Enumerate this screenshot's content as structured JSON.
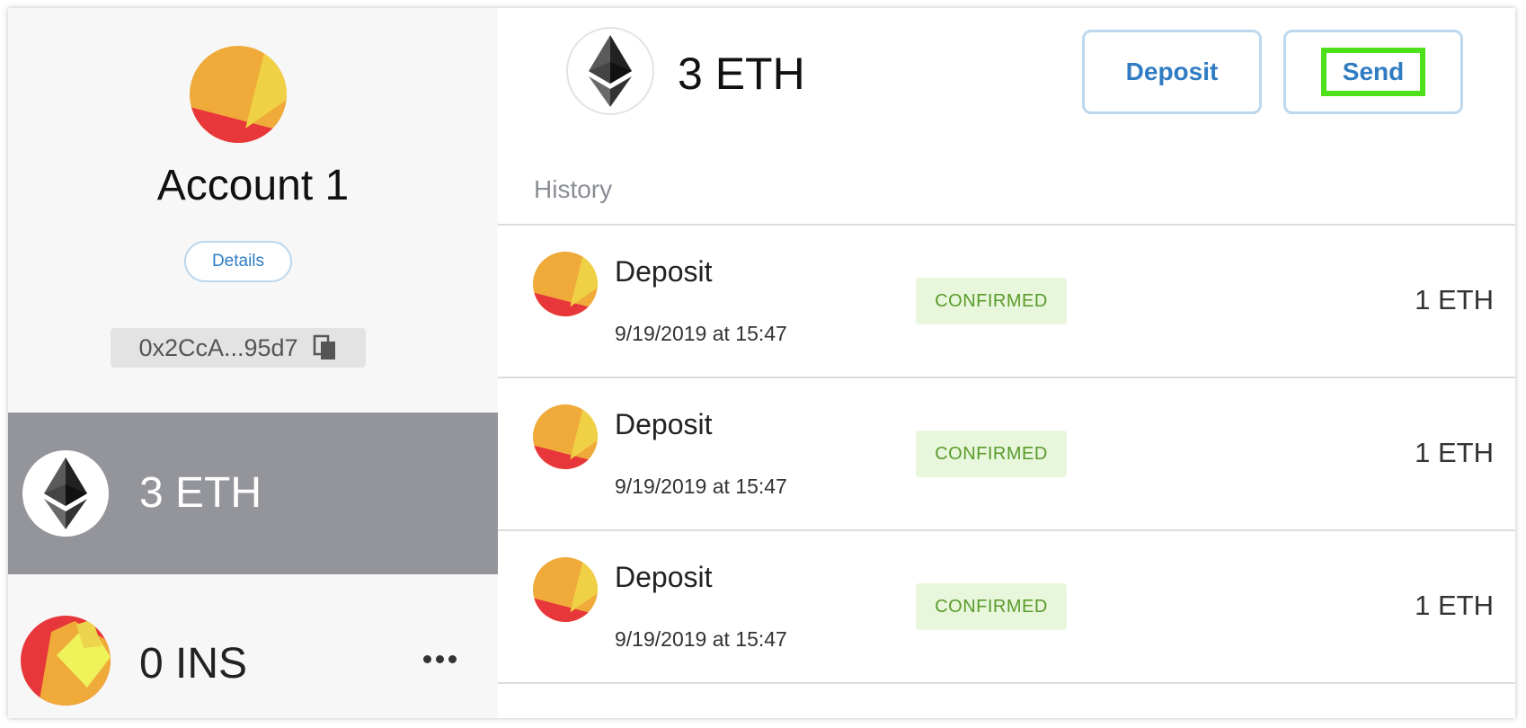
{
  "account": {
    "name": "Account 1",
    "details_label": "Details",
    "address": "0x2CcA...95d7"
  },
  "tokens": [
    {
      "amount": "3 ETH",
      "icon": "ethereum-icon",
      "selected": true
    },
    {
      "amount": "0 INS",
      "icon": "ins-token-avatar",
      "selected": false
    }
  ],
  "main": {
    "balance": "3 ETH",
    "deposit_label": "Deposit",
    "send_label": "Send",
    "history_title": "History"
  },
  "history": [
    {
      "title": "Deposit",
      "date": "9/19/2019 at 15:47",
      "status": "CONFIRMED",
      "amount": "1 ETH"
    },
    {
      "title": "Deposit",
      "date": "9/19/2019 at 15:47",
      "status": "CONFIRMED",
      "amount": "1 ETH"
    },
    {
      "title": "Deposit",
      "date": "9/19/2019 at 15:47",
      "status": "CONFIRMED",
      "amount": "1 ETH"
    }
  ],
  "colors": {
    "accent_blue": "#2f7cc3",
    "button_border": "#bcd8ee",
    "selected_row": "#94959b",
    "confirmed_bg": "#e8f7dc",
    "confirmed_text": "#5a9a2a",
    "highlight_green": "#4fe01c"
  }
}
